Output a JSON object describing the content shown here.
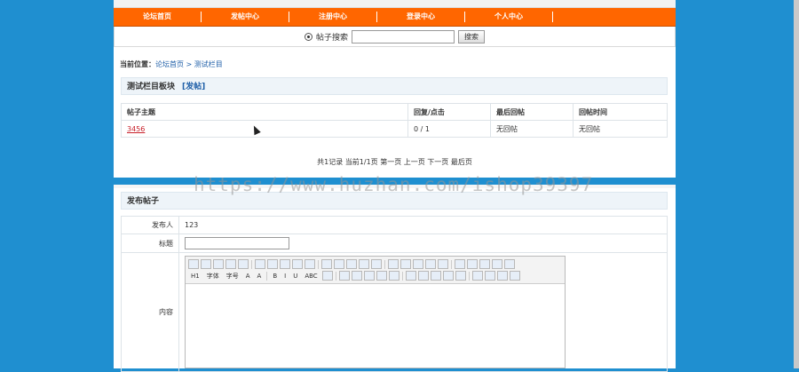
{
  "nav": {
    "items": [
      "论坛首页",
      "发帖中心",
      "注册中心",
      "登录中心",
      "个人中心"
    ]
  },
  "search": {
    "radio_label": "帖子搜索",
    "value": "",
    "button": "搜索"
  },
  "breadcrumb": {
    "prefix": "当前位置：",
    "home": "论坛首页",
    "sep": " > ",
    "current": "测试栏目"
  },
  "section": {
    "title": "测试栏目板块",
    "post_link": "[发帖]"
  },
  "topics": {
    "headers": [
      "帖子主题",
      "回复/点击",
      "最后回帖",
      "回帖时间"
    ],
    "rows": [
      [
        "3456",
        "0 / 1",
        "无回帖",
        "无回帖"
      ]
    ]
  },
  "pager": {
    "text": "共1记录  当前1/1页   第一页 上一页 下一页 最后页"
  },
  "watermark": "https://www.huzhan.com/ishop39397",
  "post_form": {
    "title": "发布帖子",
    "author_label": "发布人",
    "author_value": "123",
    "subject_label": "标题",
    "subject_value": "",
    "content_label": "内容",
    "toolbar_row1": [
      "源码",
      "撤销",
      "重做",
      "预览",
      "打印",
      "模板",
      "代码",
      "剪切",
      "复制",
      "粘贴",
      "纯文本",
      "Word",
      "左对齐",
      "居中",
      "右对齐",
      "两端",
      "编号",
      "项目",
      "缩进",
      "减少",
      "下标",
      "上标",
      "清除",
      "全选",
      "选择"
    ],
    "toolbar_row2": [
      "H1",
      "字体",
      "字号",
      "A",
      "A",
      "B",
      "I",
      "U",
      "ABC",
      "表格",
      "删除",
      "图片",
      "Flash",
      "媒体",
      "文件",
      "附件",
      "表格",
      "横线",
      "表情",
      "分页",
      "模板",
      "锚点",
      "链接",
      "取消"
    ]
  }
}
